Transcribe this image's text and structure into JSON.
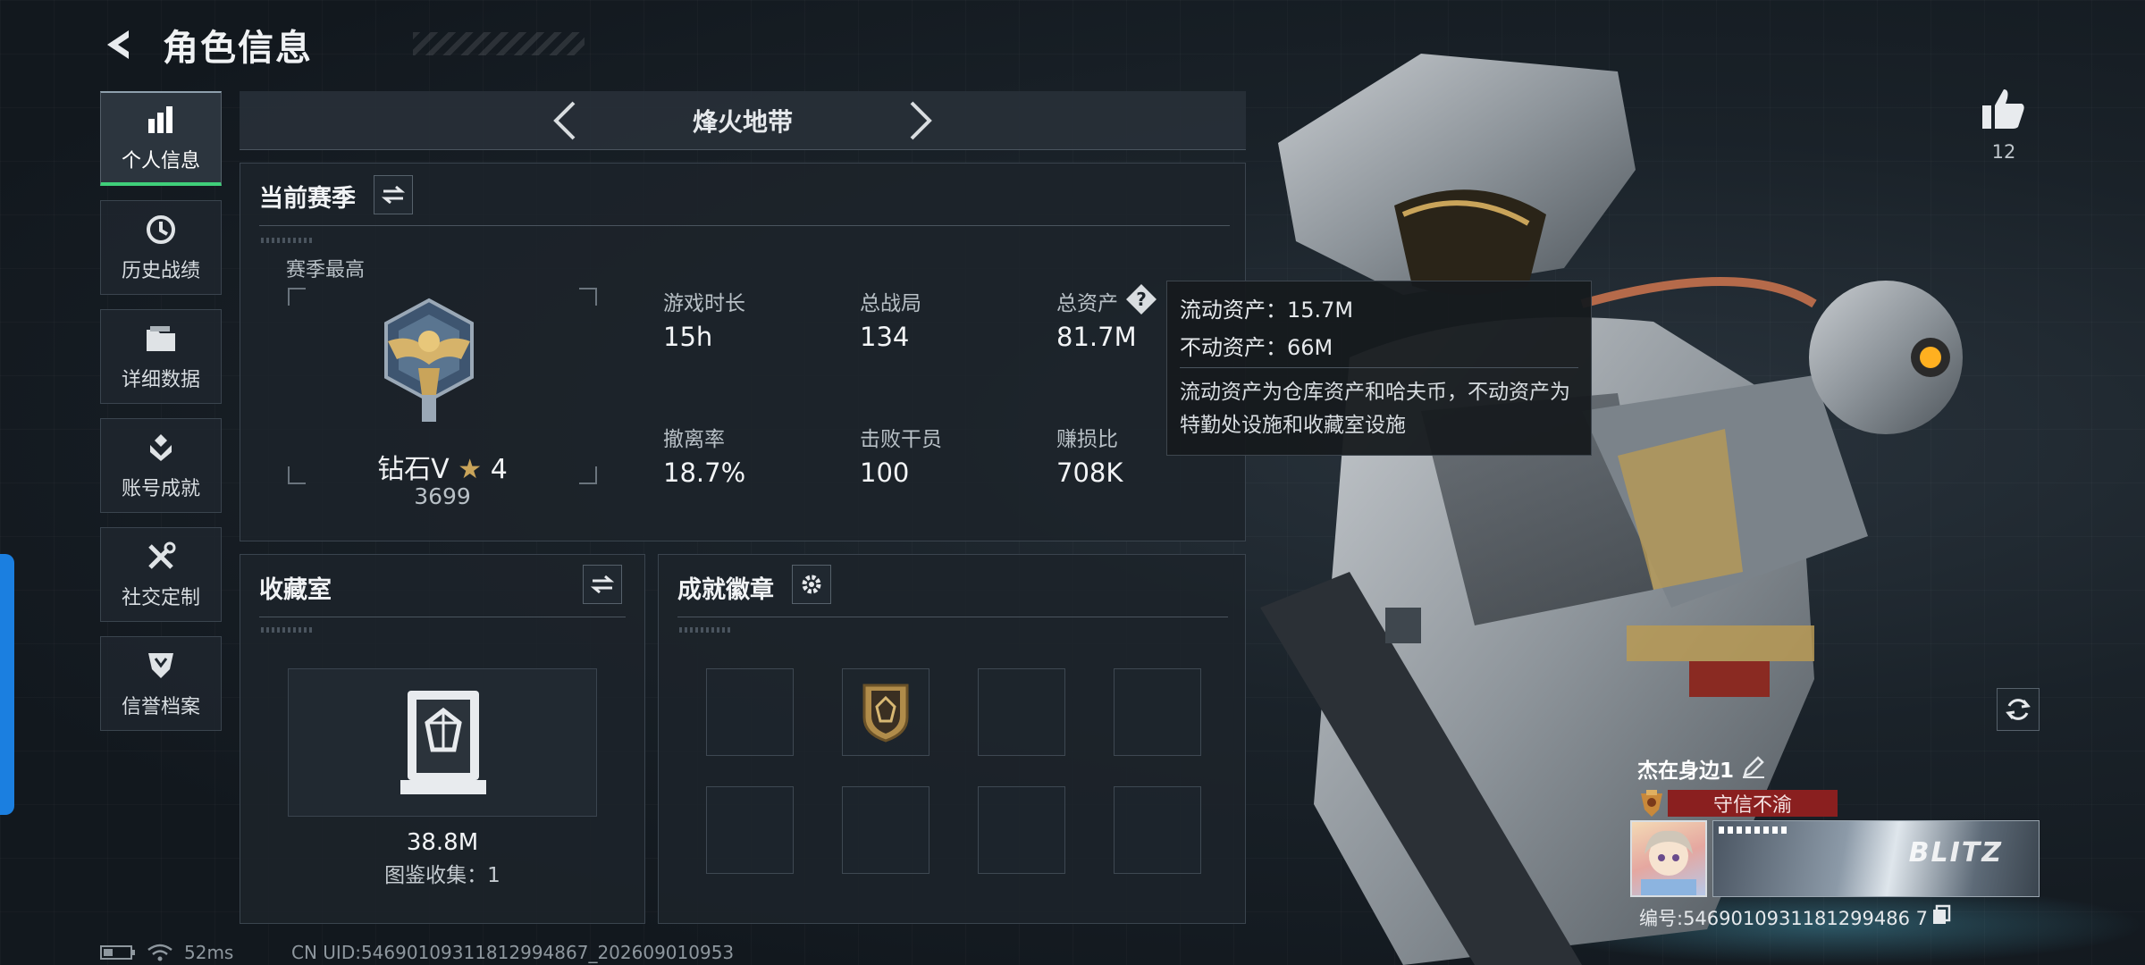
{
  "header": {
    "title": "角色信息"
  },
  "sidebar": {
    "items": [
      {
        "label": "个人信息",
        "icon": "bar-chart-icon",
        "active": true
      },
      {
        "label": "历史战绩",
        "icon": "history-clock-icon"
      },
      {
        "label": "详细数据",
        "icon": "folder-icon"
      },
      {
        "label": "账号成就",
        "icon": "achievement-icon"
      },
      {
        "label": "社交定制",
        "icon": "tools-icon"
      },
      {
        "label": "信誉档案",
        "icon": "shield-icon"
      }
    ]
  },
  "mode_selector": {
    "label": "烽火地带"
  },
  "season": {
    "title": "当前赛季",
    "best_label": "赛季最高",
    "rank_name": "钻石V",
    "rank_stars": "4",
    "rank_score": "3699",
    "stats": [
      {
        "label": "游戏时长",
        "value": "15h"
      },
      {
        "label": "总战局",
        "value": "134"
      },
      {
        "label": "总资产",
        "value": "81.7M"
      },
      {
        "label": "撤离率",
        "value": "18.7%"
      },
      {
        "label": "击败干员",
        "value": "100"
      },
      {
        "label": "赚损比",
        "value": "708K"
      }
    ]
  },
  "tooltip": {
    "liquid": "流动资产：15.7M",
    "fixed": "不动资产：66M",
    "desc": "流动资产为仓库资产和哈夫币，不动资产为特勤处设施和收藏室设施"
  },
  "vault": {
    "title": "收藏室",
    "value": "38.8M",
    "collection": "图鉴收集：1"
  },
  "badges": {
    "title": "成就徽章"
  },
  "profile": {
    "likes": "12",
    "name": "杰在身边1",
    "title_badge": "守信不渝",
    "banner_text": "BLITZ",
    "id_text": "编号:5469010931181299486 7"
  },
  "status": {
    "ping": "52ms",
    "uid": "CN UID:54690109311812994867_202609010953"
  },
  "colors": {
    "accent_green": "#3fcf7a",
    "accent_blue": "#1b7fe0",
    "title_red": "#8a1f1f",
    "gold": "#c9a45a"
  }
}
